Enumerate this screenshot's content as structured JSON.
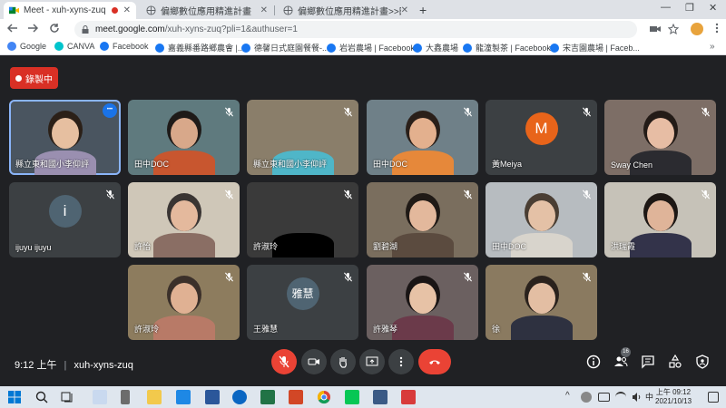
{
  "browser": {
    "tabs": [
      {
        "label": "Meet - xuh-xyns-zuq",
        "active": true,
        "recording": true
      },
      {
        "label": "偏鄉數位應用精進計畫",
        "active": false
      },
      {
        "label": "偏鄉數位應用精進計畫>>田中DOC",
        "active": false
      }
    ],
    "close_glyph": "✕",
    "new_tab_glyph": "+",
    "window_controls": [
      "—",
      "❐",
      "✕"
    ],
    "url_host": "meet.google.com",
    "url_path": "/xuh-xyns-zuq?pli=1&authuser=1"
  },
  "bookmarks": [
    {
      "label": "Google",
      "color": "#4285f4"
    },
    {
      "label": "CANVA",
      "color": "#00c4cc"
    },
    {
      "label": "Facebook",
      "color": "#1877f2"
    },
    {
      "label": "嘉義縣番路鄉農會 |...",
      "color": "#1877f2"
    },
    {
      "label": "德馨日式庭園餐餐-...",
      "color": "#1877f2"
    },
    {
      "label": "岩岩農場 | Facebook",
      "color": "#1877f2"
    },
    {
      "label": "大鑫農場",
      "color": "#1877f2"
    },
    {
      "label": "龍潼製茶 | Facebook",
      "color": "#1877f2"
    },
    {
      "label": "宋吉園農場 | Faceb...",
      "color": "#1877f2"
    }
  ],
  "bookmarks_more": "»",
  "meet": {
    "recording_label": "錄製中",
    "meeting_time": "9:12 上午",
    "meeting_code": "xuh-xyns-zuq",
    "separator": "|",
    "participant_count": "16",
    "tiles": [
      {
        "name": "縣立東和國小李仰評",
        "kind": "video",
        "bg": "#4a5560",
        "skin": "#e6bfa0",
        "hair": "#2b2018",
        "shirt": "#9a8fb0",
        "active": true,
        "menu": true
      },
      {
        "name": "田中DOC",
        "kind": "video",
        "bg": "#5f7a7e",
        "skin": "#d8a88a",
        "hair": "#1e1a18",
        "shirt": "#c8562f"
      },
      {
        "name": "縣立東和國小李仰評",
        "kind": "video",
        "bg": "#8a7e6a",
        "skin": "#00000000",
        "hair": "#00000000",
        "shirt": "#4fb6c8"
      },
      {
        "name": "田中DOC",
        "kind": "video",
        "bg": "#6f8088",
        "skin": "#e3b08e",
        "hair": "#2a1f19",
        "shirt": "#e6883a"
      },
      {
        "name": "黃Meiya",
        "kind": "avatar",
        "initial": "M",
        "avatar_color": "#e8641a"
      },
      {
        "name": "Sway Chen",
        "kind": "video",
        "bg": "#7d6e66",
        "skin": "#e7bda4",
        "hair": "#231b17",
        "shirt": "#2b2b30"
      },
      {
        "name": "ijuyu ijuyu",
        "kind": "avatar",
        "initial": "i",
        "avatar_color": "#4f6472"
      },
      {
        "name": "許怡",
        "kind": "video",
        "bg": "#cfc7b8",
        "skin": "#e4b99d",
        "hair": "#3a3533",
        "shirt": "#8a6e64"
      },
      {
        "name": "許淑玲",
        "kind": "video",
        "bg": "#3a3a3a",
        "skin": "#00000000",
        "hair": "#00000000",
        "shirt": "#000000"
      },
      {
        "name": "劉碧湖",
        "kind": "video",
        "bg": "#7a6e5e",
        "skin": "#e3b89c",
        "hair": "#201a16",
        "shirt": "#5b4b3f"
      },
      {
        "name": "田中DOC",
        "kind": "video",
        "bg": "#b7bcc0",
        "skin": "#e4c1a6",
        "hair": "#4a3e33",
        "shirt": "#d8d4cc"
      },
      {
        "name": "洪瑞霞",
        "kind": "video",
        "bg": "#c6c2b8",
        "skin": "#dfb499",
        "hair": "#1d1714",
        "shirt": "#33334a"
      },
      {
        "name": "許淑玲",
        "kind": "video",
        "bg": "#8d7c5e",
        "skin": "#e0b193",
        "hair": "#3b302a",
        "shirt": "#b87a67"
      },
      {
        "name": "王雅慧",
        "kind": "avatar",
        "initial": "雅慧",
        "avatar_color": "#4f6472"
      },
      {
        "name": "許雅琴",
        "kind": "video",
        "bg": "#6b6060",
        "skin": "#e7c2a6",
        "hair": "#1a1515",
        "shirt": "#6b3a4a"
      },
      {
        "name": "徐",
        "kind": "video",
        "bg": "#8a7a60",
        "skin": "#e3bea3",
        "hair": "#2a221d",
        "shirt": "#2e3140"
      }
    ]
  },
  "taskbar": {
    "time": "上午 09:12",
    "date": "2021/10/13"
  }
}
